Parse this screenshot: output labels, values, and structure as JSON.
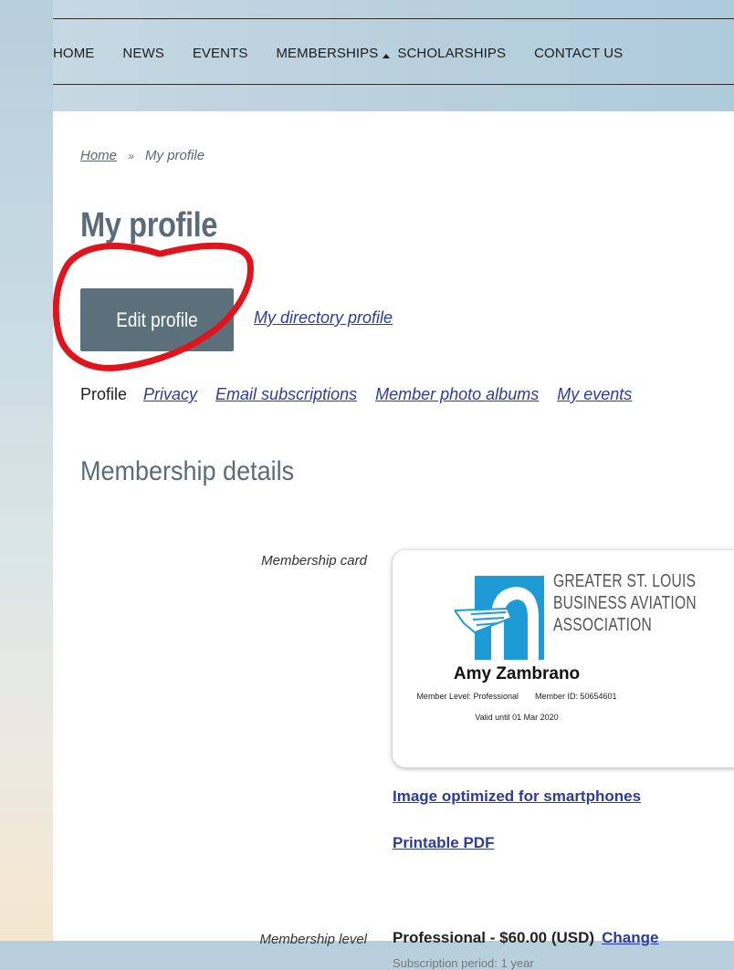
{
  "nav": {
    "items": [
      {
        "label": "HOME"
      },
      {
        "label": "NEWS"
      },
      {
        "label": "EVENTS"
      },
      {
        "label": "MEMBERSHIPS",
        "has_dropdown": true
      },
      {
        "label": "SCHOLARSHIPS"
      },
      {
        "label": "CONTACT US"
      }
    ]
  },
  "breadcrumb": {
    "home": "Home",
    "separator": "»",
    "current": "My profile"
  },
  "page": {
    "title": "My profile",
    "edit_button": "Edit profile",
    "directory_link": "My directory profile"
  },
  "tabs": {
    "current": "Profile",
    "links": [
      "Privacy",
      "Email subscriptions",
      "Member photo albums",
      "My events"
    ]
  },
  "membership": {
    "section_title": "Membership details",
    "card_label": "Membership card",
    "card": {
      "org_line1": "GREATER ST. LOUIS",
      "org_line2": "BUSINESS AVIATION",
      "org_line3": "ASSOCIATION",
      "member_name": "Amy Zambrano",
      "member_level": "Member Level: Professional",
      "member_id": "Member ID: 50654601",
      "valid_until": "Valid until 01 Mar 2020",
      "logo_color": "#1e9ad6"
    },
    "smartphone_link": "Image optimized for smartphones",
    "pdf_link": "Printable PDF",
    "level_label": "Membership level",
    "level_value": "Professional - $60.00 (USD)",
    "change_link": "Change",
    "subscription_period": "Subscription period: 1 year"
  },
  "colors": {
    "link": "#2b3c9a",
    "button_bg": "#5c707c",
    "heading": "#5b6b77",
    "annotation": "#e0141c"
  }
}
